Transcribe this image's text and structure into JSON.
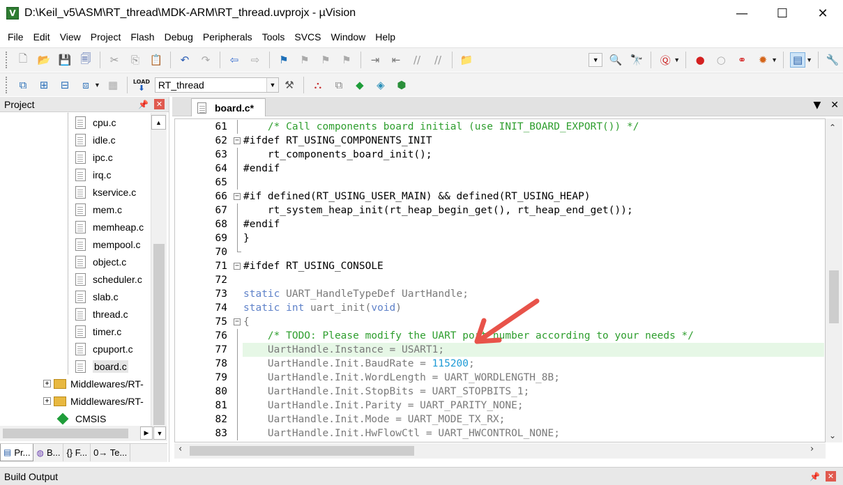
{
  "window": {
    "title": "D:\\Keil_v5\\ASM\\RT_thread\\MDK-ARM\\RT_thread.uvprojx - µVision",
    "app_icon_letter": "V",
    "controls": {
      "minimize": "—",
      "maximize": "☐",
      "close": "✕"
    }
  },
  "menu": [
    "File",
    "Edit",
    "View",
    "Project",
    "Flash",
    "Debug",
    "Peripherals",
    "Tools",
    "SVCS",
    "Window",
    "Help"
  ],
  "toolbar2": {
    "target": "RT_thread",
    "load_label": "LOAD"
  },
  "project_pane": {
    "title": "Project",
    "files": [
      "cpu.c",
      "idle.c",
      "ipc.c",
      "irq.c",
      "kservice.c",
      "mem.c",
      "memheap.c",
      "mempool.c",
      "object.c",
      "scheduler.c",
      "slab.c",
      "thread.c",
      "timer.c",
      "cpuport.c",
      "board.c"
    ],
    "selected_file": "board.c",
    "folders": [
      "Middlewares/RT-",
      "Middlewares/RT-"
    ],
    "cmsis": "CMSIS",
    "tabs": [
      "Pr...",
      "B...",
      "{} F...",
      "0→ Te..."
    ]
  },
  "editor": {
    "tab_label": "board.c*",
    "highlight_line": "77",
    "lines": [
      {
        "n": "61",
        "fold": "line",
        "html": "<span class=\"c-comment\">    /* Call components board initial (use INIT_BOARD_EXPORT()) */</span>"
      },
      {
        "n": "62",
        "fold": "box",
        "html": "<span class=\"c-dir\">#ifdef RT_USING_COMPONENTS_INIT</span>"
      },
      {
        "n": "63",
        "fold": "line",
        "html": "    rt_components_board_init();"
      },
      {
        "n": "64",
        "fold": "line",
        "html": "#endif"
      },
      {
        "n": "65",
        "fold": "line",
        "html": ""
      },
      {
        "n": "66",
        "fold": "box",
        "html": "#if defined(RT_USING_USER_MAIN) &amp;&amp; defined(RT_USING_HEAP)"
      },
      {
        "n": "67",
        "fold": "line",
        "html": "    rt_system_heap_init(rt_heap_begin_get(), rt_heap_end_get());"
      },
      {
        "n": "68",
        "fold": "line",
        "html": "#endif"
      },
      {
        "n": "69",
        "fold": "line",
        "html": "}"
      },
      {
        "n": "70",
        "fold": "end",
        "html": ""
      },
      {
        "n": "71",
        "fold": "box",
        "html": "#ifdef RT_USING_CONSOLE"
      },
      {
        "n": "72",
        "fold": "",
        "html": ""
      },
      {
        "n": "73",
        "fold": "",
        "html": "<span class=\"c-kw\">static</span> <span class=\"c-gray\">UART_HandleTypeDef UartHandle;</span>"
      },
      {
        "n": "74",
        "fold": "",
        "html": "<span class=\"c-kw\">static int</span> <span class=\"c-gray\">uart_init(</span><span class=\"c-kw\">void</span><span class=\"c-gray\">)</span>"
      },
      {
        "n": "75",
        "fold": "box",
        "html": "<span class=\"c-gray\">{</span>"
      },
      {
        "n": "76",
        "fold": "line",
        "html": "<span class=\"c-comment\">    /* TODO: Please modify the UART port number according to your needs */</span>"
      },
      {
        "n": "77",
        "fold": "line",
        "html": "<span class=\"c-gray\">    UartHandle.Instance = USART1;</span>"
      },
      {
        "n": "78",
        "fold": "line",
        "html": "<span class=\"c-gray\">    UartHandle.Init.BaudRate = </span><span class=\"c-num\">115200</span><span class=\"c-gray\">;</span>"
      },
      {
        "n": "79",
        "fold": "line",
        "html": "<span class=\"c-gray\">    UartHandle.Init.WordLength = UART_WORDLENGTH_8B;</span>"
      },
      {
        "n": "80",
        "fold": "line",
        "html": "<span class=\"c-gray\">    UartHandle.Init.StopBits = UART_STOPBITS_1;</span>"
      },
      {
        "n": "81",
        "fold": "line",
        "html": "<span class=\"c-gray\">    UartHandle.Init.Parity = UART_PARITY_NONE;</span>"
      },
      {
        "n": "82",
        "fold": "line",
        "html": "<span class=\"c-gray\">    UartHandle.Init.Mode = UART_MODE_TX_RX;</span>"
      },
      {
        "n": "83",
        "fold": "line",
        "html": "<span class=\"c-gray\">    UartHandle.Init.HwFlowCtl = UART_HWCONTROL_NONE;</span>"
      }
    ]
  },
  "build_output": {
    "title": "Build Output"
  },
  "annotation": {
    "arrow_color": "#e8534a"
  }
}
